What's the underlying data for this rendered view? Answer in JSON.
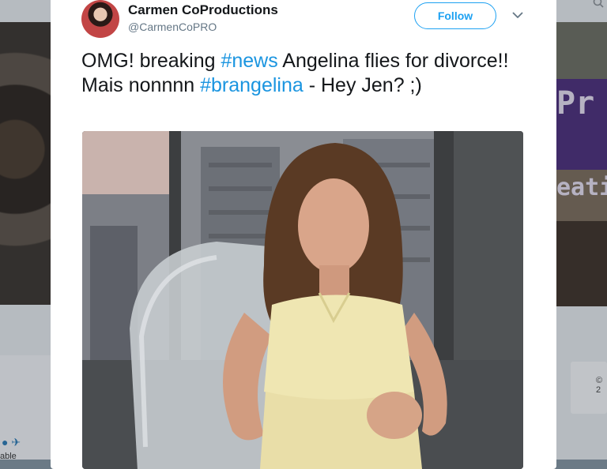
{
  "tweet": {
    "display_name": "Carmen CoProductions",
    "handle": "@CarmenCoPRO",
    "follow_label": "Follow",
    "text_parts": [
      {
        "text": "OMG! breaking ",
        "type": "text"
      },
      {
        "text": "#news",
        "type": "hashtag"
      },
      {
        "text": " Angelina flies for divorce!! Mais nonnnn ",
        "type": "text"
      },
      {
        "text": "#brangelina",
        "type": "hashtag"
      },
      {
        "text": " - Hey Jen? ;)",
        "type": "text"
      }
    ]
  },
  "background": {
    "banner_text_1": "Pr",
    "banner_text_2": "eati",
    "left_text": "able",
    "footer_text": "© 2"
  },
  "colors": {
    "accent": "#1da1f2",
    "hashtag": "#1b95e0",
    "text": "#14171a",
    "muted": "#657786"
  },
  "icons": {
    "caret": "chevron-down-icon",
    "search": "search-icon"
  }
}
